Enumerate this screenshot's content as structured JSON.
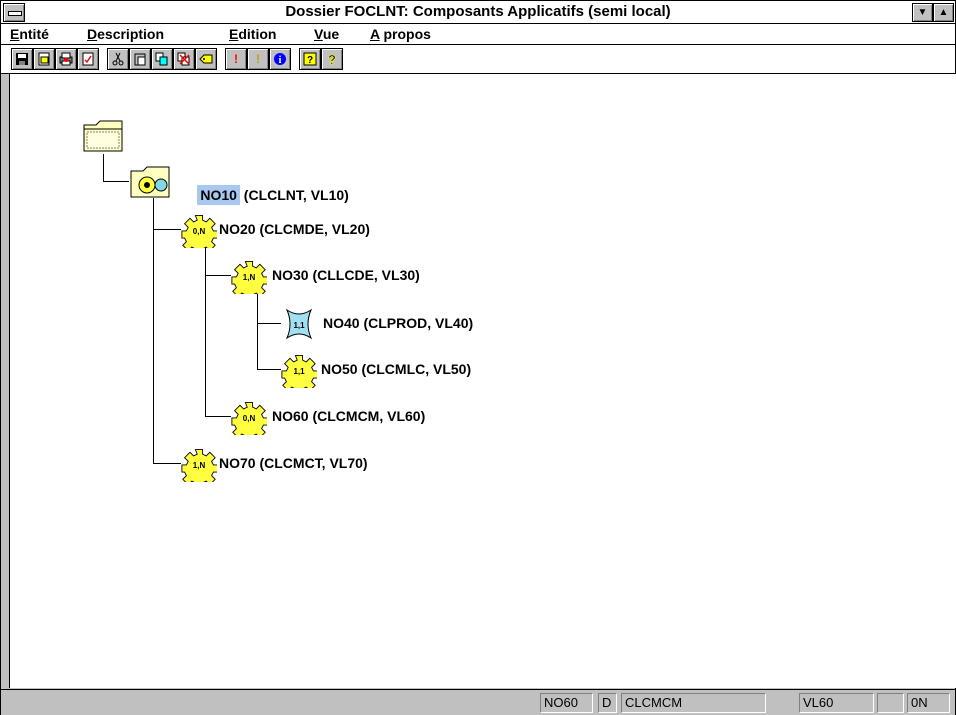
{
  "window": {
    "title": "Dossier FOCLNT: Composants Applicatifs (semi local)"
  },
  "menu": [
    {
      "key": "E",
      "rest": "ntité"
    },
    {
      "key": "D",
      "rest": "escription"
    },
    {
      "key": "E",
      "rest": "dition"
    },
    {
      "key": "V",
      "rest": "ue"
    },
    {
      "key": "A",
      "rest": " propos"
    }
  ],
  "toolbar": {
    "icons": [
      "save-icon",
      "open-icon",
      "print-icon",
      "check-document-icon",
      "cut-icon",
      "paste-icon",
      "copy-icon",
      "delete-icon",
      "tag-icon",
      "exclamation-red-icon",
      "exclamation-yellow-icon",
      "info-icon",
      "help-icon",
      "context-help-icon"
    ]
  },
  "tree": {
    "root": {
      "icon": "folder-icon"
    },
    "nodes": [
      {
        "name": "NO10",
        "detail": " (CLCLNT, VL10)",
        "card": "",
        "icon": "folder-gears-icon",
        "selected": true
      },
      {
        "name": "NO20",
        "detail": " (CLCMDE, VL20)",
        "card": "0,N",
        "icon": "gear-icon"
      },
      {
        "name": "NO30",
        "detail": " (CLLCDE, VL30)",
        "card": "1,N",
        "icon": "gear-icon"
      },
      {
        "name": "NO40",
        "detail": " (CLPROD, VL40)",
        "card": "1,1",
        "icon": "cross-icon"
      },
      {
        "name": "NO50",
        "detail": " (CLCMLC, VL50)",
        "card": "1,1",
        "icon": "gear-icon"
      },
      {
        "name": "NO60",
        "detail": " (CLCMCM, VL60)",
        "card": "0,N",
        "icon": "gear-icon"
      },
      {
        "name": "NO70",
        "detail": " (CLCMCT, VL70)",
        "card": "1,N",
        "icon": "gear-icon"
      }
    ]
  },
  "status": {
    "node": "NO60",
    "flag": "D",
    "cl": "CLCMCM",
    "vl": "VL60",
    "empty": "",
    "card": "0N"
  },
  "colors": {
    "gear": "#ffff40",
    "cross": "#a0e0f0",
    "selection": "#a8c8f0",
    "folder": "#ffffc0"
  }
}
